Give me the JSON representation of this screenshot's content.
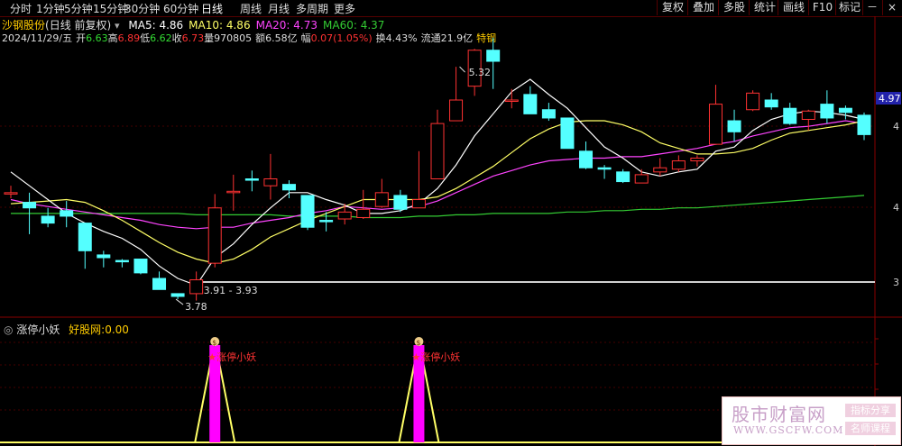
{
  "periods": [
    "分时",
    "1分钟",
    "5分钟",
    "15分钟",
    "30分钟",
    "60分钟",
    "日线",
    "周线",
    "月线",
    "多周期",
    "更多"
  ],
  "active_period": "日线",
  "right_buttons": [
    "复权",
    "叠加",
    "多股",
    "统计",
    "画线",
    "F10",
    "标记"
  ],
  "window_controls": {
    "minus": "－",
    "close": "×"
  },
  "security": {
    "name": "沙钢股份",
    "mode": "(日线 前复权)"
  },
  "ma": [
    {
      "label": "MA5:",
      "value": "4.86",
      "color": "#ffffff"
    },
    {
      "label": "MA10:",
      "value": "4.86",
      "color": "#ffff66"
    },
    {
      "label": "MA20:",
      "value": "4.73",
      "color": "#ff44ff"
    },
    {
      "label": "MA60:",
      "value": "4.37",
      "color": "#33cc33"
    }
  ],
  "quote": {
    "date": "2024/11/29/五",
    "open_label": "开",
    "open": "6.63",
    "high_label": "高",
    "high": "6.89",
    "low_label": "低",
    "low": "6.62",
    "close_label": "收",
    "close": "6.73",
    "vol_label": "量",
    "vol": "970805",
    "amt_label": "额",
    "amt": "6.58亿",
    "chg_label": "幅",
    "chg": "0.07(1.05%)",
    "turn_label": "换",
    "turn": "4.43%",
    "float_label": "流通",
    "float": "21.9亿",
    "tag": "特钢"
  },
  "indicator": {
    "name": "涨停小妖",
    "extra_label": "好股网:",
    "extra_value": "0.00"
  },
  "annotations": {
    "high": "5.32",
    "low": "3.78",
    "range": "3.91 - 3.93",
    "last_price": "4.97",
    "signal": "涨停小妖",
    "signal_marker": "$"
  },
  "axis_labels": [
    "4",
    "4",
    "3"
  ],
  "colors": {
    "up": "#ff3232",
    "down": "#54ffff",
    "ma5": "#ffffff",
    "ma10": "#ffff66",
    "ma20": "#ff44ff",
    "ma60": "#33cc33",
    "signal": "#ff00ff"
  },
  "candles": [
    [
      4.45,
      4.45,
      4.5,
      4.41
    ],
    [
      4.38,
      4.34,
      4.45,
      4.15
    ],
    [
      4.28,
      4.23,
      4.34,
      4.2
    ],
    [
      4.32,
      4.28,
      4.39,
      4.2
    ],
    [
      4.23,
      4.03,
      4.23,
      3.9
    ],
    [
      4.0,
      3.98,
      4.03,
      3.91
    ],
    [
      3.96,
      3.95,
      3.97,
      3.91
    ],
    [
      3.97,
      3.87,
      3.97,
      3.86
    ],
    [
      3.83,
      3.75,
      3.88,
      3.8
    ],
    [
      3.72,
      3.7,
      3.72,
      3.68
    ],
    [
      3.72,
      3.82,
      3.88,
      3.67
    ],
    [
      3.94,
      4.34,
      4.44,
      3.91
    ],
    [
      4.46,
      4.46,
      4.58,
      4.32
    ],
    [
      4.55,
      4.54,
      4.61,
      4.46
    ],
    [
      4.5,
      4.55,
      4.73,
      4.4
    ],
    [
      4.51,
      4.47,
      4.54,
      4.41
    ],
    [
      4.43,
      4.2,
      4.43,
      4.18
    ],
    [
      4.25,
      4.24,
      4.31,
      4.17
    ],
    [
      4.26,
      4.31,
      4.37,
      4.22
    ],
    [
      4.27,
      4.33,
      4.47,
      4.26
    ],
    [
      4.35,
      4.45,
      4.55,
      4.34
    ],
    [
      4.43,
      4.33,
      4.47,
      4.31
    ],
    [
      4.34,
      4.4,
      4.75,
      4.34
    ],
    [
      4.55,
      4.95,
      5.05,
      4.55
    ],
    [
      4.97,
      5.12,
      5.36,
      4.97
    ],
    [
      5.22,
      5.48,
      5.49,
      5.15
    ],
    [
      5.48,
      5.4,
      5.57,
      5.2
    ],
    [
      5.12,
      5.12,
      5.2,
      5.06
    ],
    [
      5.16,
      5.02,
      5.22,
      5.02
    ],
    [
      5.05,
      4.99,
      5.1,
      4.97
    ],
    [
      4.99,
      4.77,
      4.99,
      4.79
    ],
    [
      4.75,
      4.63,
      4.82,
      4.62
    ],
    [
      4.63,
      4.62,
      4.65,
      4.55
    ],
    [
      4.6,
      4.53,
      4.62,
      4.52
    ],
    [
      4.52,
      4.58,
      4.62,
      4.52
    ],
    [
      4.6,
      4.63,
      4.7,
      4.57
    ],
    [
      4.62,
      4.68,
      4.72,
      4.6
    ],
    [
      4.68,
      4.7,
      4.72,
      4.64
    ],
    [
      4.8,
      5.09,
      5.23,
      4.8
    ],
    [
      4.97,
      4.89,
      5.05,
      4.82
    ],
    [
      5.05,
      5.17,
      5.19,
      5.04
    ],
    [
      5.12,
      5.07,
      5.17,
      5.05
    ],
    [
      5.06,
      4.95,
      5.1,
      4.94
    ],
    [
      4.98,
      5.04,
      5.05,
      4.9
    ],
    [
      5.09,
      4.99,
      5.19,
      4.95
    ],
    [
      5.06,
      5.03,
      5.08,
      4.98
    ],
    [
      5.01,
      4.87,
      5.03,
      4.83
    ]
  ],
  "ma_series": {
    "ma5": [
      4.6,
      4.5,
      4.4,
      4.3,
      4.23,
      4.17,
      4.12,
      4.04,
      3.92,
      3.83,
      3.78,
      3.98,
      4.08,
      4.22,
      4.34,
      4.45,
      4.45,
      4.4,
      4.36,
      4.3,
      4.3,
      4.32,
      4.37,
      4.48,
      4.65,
      4.86,
      5.02,
      5.18,
      5.27,
      5.16,
      5.06,
      4.92,
      4.78,
      4.7,
      4.6,
      4.57,
      4.6,
      4.62,
      4.75,
      4.78,
      4.9,
      4.98,
      5.02,
      5.04,
      5.03,
      5.01,
      4.98
    ],
    "ma10": [
      4.37,
      4.38,
      4.39,
      4.4,
      4.38,
      4.32,
      4.25,
      4.17,
      4.09,
      4.02,
      3.97,
      3.94,
      3.97,
      4.04,
      4.13,
      4.19,
      4.25,
      4.3,
      4.35,
      4.4,
      4.4,
      4.4,
      4.4,
      4.42,
      4.48,
      4.56,
      4.64,
      4.74,
      4.84,
      4.91,
      4.96,
      4.97,
      4.97,
      4.94,
      4.89,
      4.81,
      4.77,
      4.73,
      4.73,
      4.74,
      4.77,
      4.83,
      4.88,
      4.9,
      4.92,
      4.94,
      4.97
    ],
    "ma20": [
      4.4,
      4.37,
      4.35,
      4.33,
      4.31,
      4.29,
      4.27,
      4.25,
      4.22,
      4.2,
      4.19,
      4.2,
      4.2,
      4.23,
      4.25,
      4.27,
      4.3,
      4.32,
      4.35,
      4.34,
      4.33,
      4.34,
      4.35,
      4.39,
      4.45,
      4.51,
      4.57,
      4.61,
      4.65,
      4.68,
      4.69,
      4.7,
      4.7,
      4.71,
      4.71,
      4.73,
      4.75,
      4.77,
      4.8,
      4.82,
      4.86,
      4.89,
      4.92,
      4.93,
      4.95,
      4.97,
      4.95
    ],
    "ma60": [
      4.3,
      4.3,
      4.3,
      4.3,
      4.3,
      4.3,
      4.3,
      4.3,
      4.3,
      4.3,
      4.29,
      4.29,
      4.29,
      4.29,
      4.29,
      4.28,
      4.28,
      4.28,
      4.28,
      4.27,
      4.27,
      4.27,
      4.28,
      4.28,
      4.29,
      4.29,
      4.3,
      4.3,
      4.3,
      4.3,
      4.31,
      4.31,
      4.32,
      4.32,
      4.33,
      4.33,
      4.34,
      4.34,
      4.35,
      4.36,
      4.37,
      4.38,
      4.39,
      4.4,
      4.41,
      4.42,
      4.43
    ]
  },
  "signal_candles": [
    11,
    22
  ]
}
